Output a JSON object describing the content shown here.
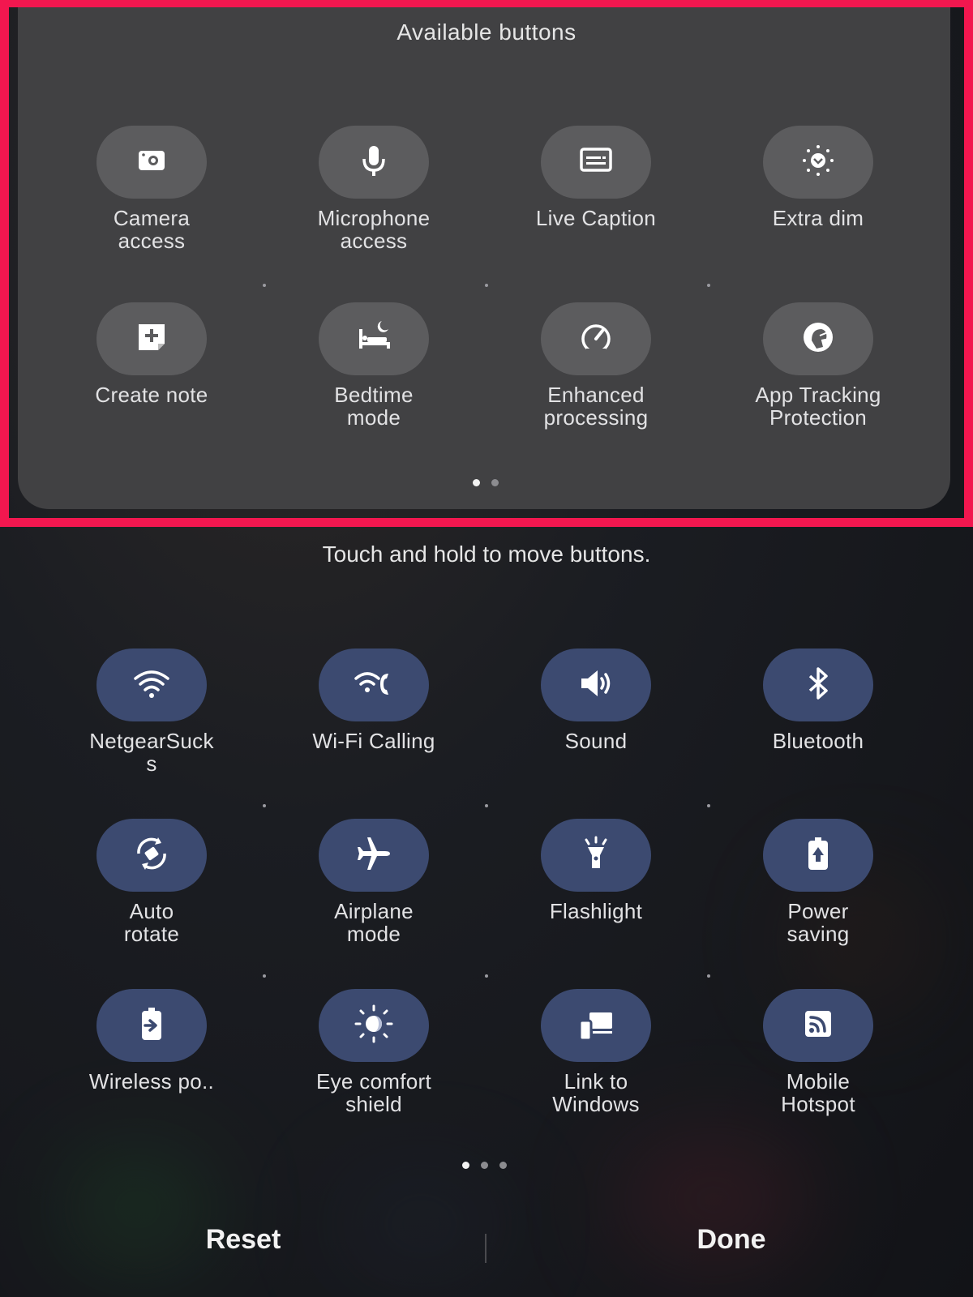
{
  "available": {
    "title": "Available buttons",
    "tiles": [
      {
        "label": "Camera\naccess",
        "icon": "camera-icon"
      },
      {
        "label": "Microphone\naccess",
        "icon": "microphone-icon"
      },
      {
        "label": "Live Caption",
        "icon": "caption-icon"
      },
      {
        "label": "Extra dim",
        "icon": "extra-dim-icon"
      },
      {
        "label": "Create note",
        "icon": "note-add-icon"
      },
      {
        "label": "Bedtime\nmode",
        "icon": "bed-icon"
      },
      {
        "label": "Enhanced\nprocessing",
        "icon": "speedometer-icon"
      },
      {
        "label": "App Tracking\nProtection",
        "icon": "tracking-protection-icon"
      }
    ],
    "pager": {
      "pages": 2,
      "current": 1
    }
  },
  "hint": "Touch and hold to move buttons.",
  "active": {
    "tiles": [
      {
        "label": "NetgearSuck\ns",
        "icon": "wifi-icon"
      },
      {
        "label": "Wi-Fi Calling",
        "icon": "wifi-calling-icon"
      },
      {
        "label": "Sound",
        "icon": "sound-icon"
      },
      {
        "label": "Bluetooth",
        "icon": "bluetooth-icon"
      },
      {
        "label": "Auto\nrotate",
        "icon": "auto-rotate-icon"
      },
      {
        "label": "Airplane\nmode",
        "icon": "airplane-icon"
      },
      {
        "label": "Flashlight",
        "icon": "flashlight-icon"
      },
      {
        "label": "Power\nsaving",
        "icon": "power-saving-icon"
      },
      {
        "label": "Wireless po..",
        "icon": "wireless-powershare-icon"
      },
      {
        "label": "Eye comfort\nshield",
        "icon": "eye-comfort-icon"
      },
      {
        "label": "Link to\nWindows",
        "icon": "link-to-windows-icon"
      },
      {
        "label": "Mobile\nHotspot",
        "icon": "hotspot-icon"
      }
    ],
    "pager": {
      "pages": 3,
      "current": 1
    }
  },
  "footer": {
    "reset": "Reset",
    "done": "Done"
  },
  "colors": {
    "highlight": "#f2174f",
    "active_tile": "#3c4a70",
    "available_tile": "#5c5c5e",
    "panel": "#414143"
  }
}
